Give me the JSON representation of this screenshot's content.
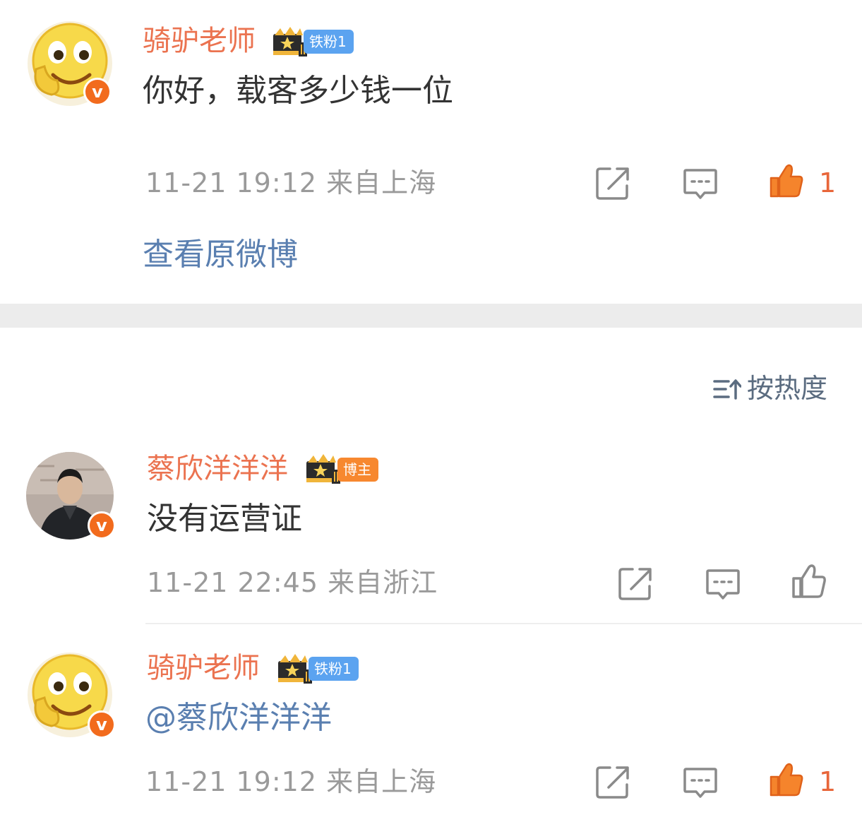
{
  "post": {
    "author": "骑驴老师",
    "badge": "铁粉1",
    "text": "你好，载客多少钱一位",
    "meta": "11-21 19:12 来自上海",
    "like_count": "1",
    "view_original": "查看原微博"
  },
  "sort": {
    "label": "按热度"
  },
  "comments": [
    {
      "author": "蔡欣洋洋洋",
      "badge": "博主",
      "text": "没有运营证",
      "meta": "11-21 22:45 来自浙江",
      "like_count": ""
    },
    {
      "author": "骑驴老师",
      "badge": "铁粉1",
      "text": "@蔡欣洋洋洋",
      "meta": "11-21 19:12 来自上海",
      "like_count": "1"
    }
  ],
  "colors": {
    "name": "#eb7350",
    "link": "#5a7fb0",
    "meta": "#9a9a9a",
    "like_active": "#f5842c",
    "fan_badge": "#5ba3f0",
    "blogger_badge": "#f7882f"
  }
}
